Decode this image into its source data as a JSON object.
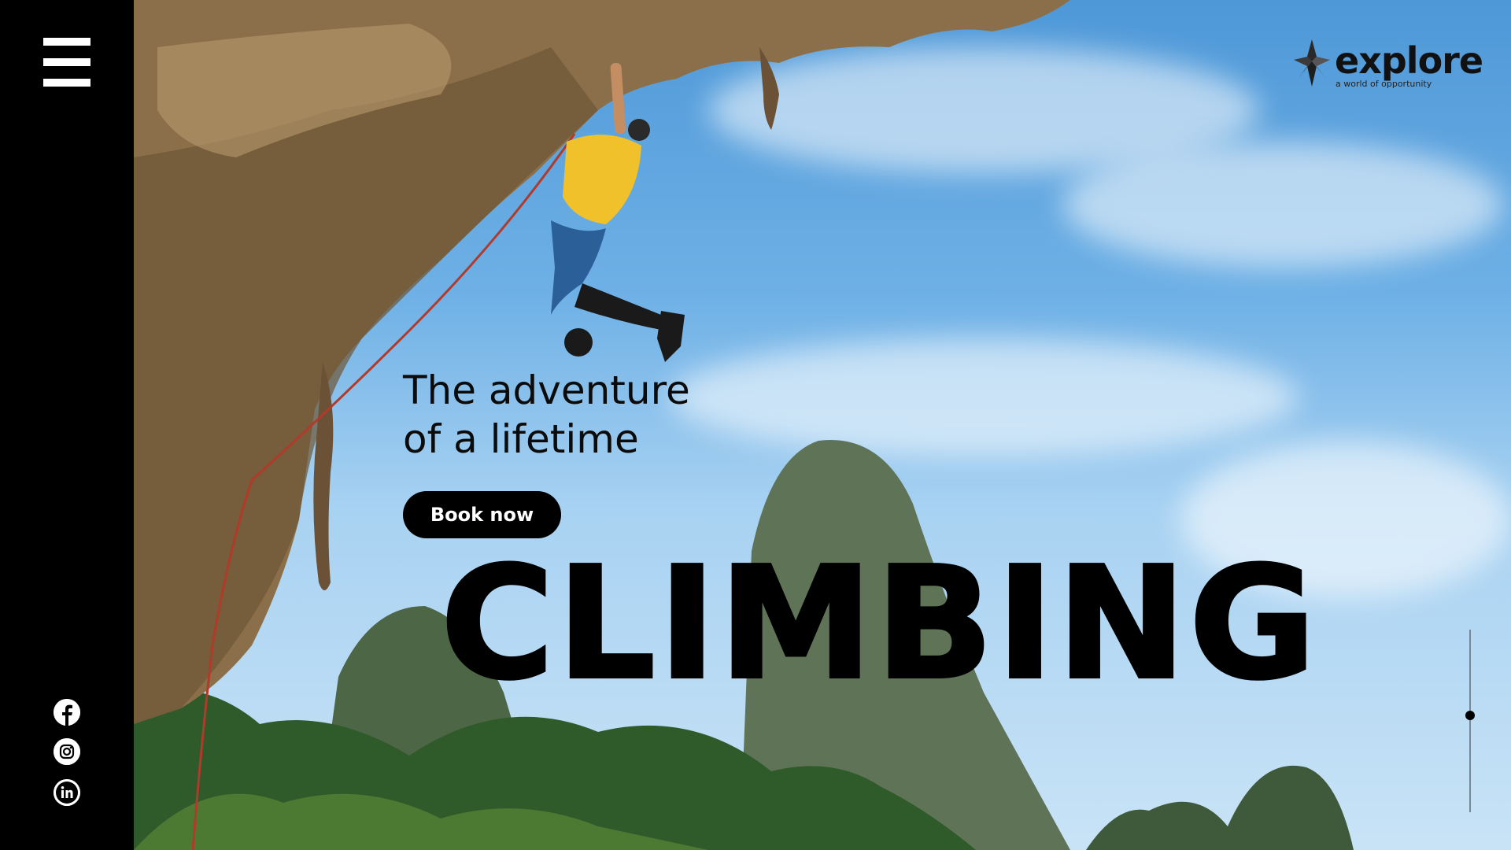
{
  "brand": {
    "name": "explore",
    "tagline": "a world of opportunity"
  },
  "hero": {
    "headline_line1": "The adventure",
    "headline_line2": "of a lifetime",
    "cta_label": "Book now",
    "activity": "CLIMBING"
  },
  "sidebar": {
    "menu_icon": "hamburger-menu-icon",
    "social": [
      {
        "name": "facebook",
        "icon": "facebook-icon"
      },
      {
        "name": "instagram",
        "icon": "instagram-icon"
      },
      {
        "name": "linkedin",
        "icon": "linkedin-icon"
      }
    ]
  },
  "slider": {
    "current_position_fraction": 0.47
  },
  "colors": {
    "sidebar": "#000000",
    "button": "#000000",
    "button_text": "#ffffff",
    "text": "#0b0b0b"
  }
}
